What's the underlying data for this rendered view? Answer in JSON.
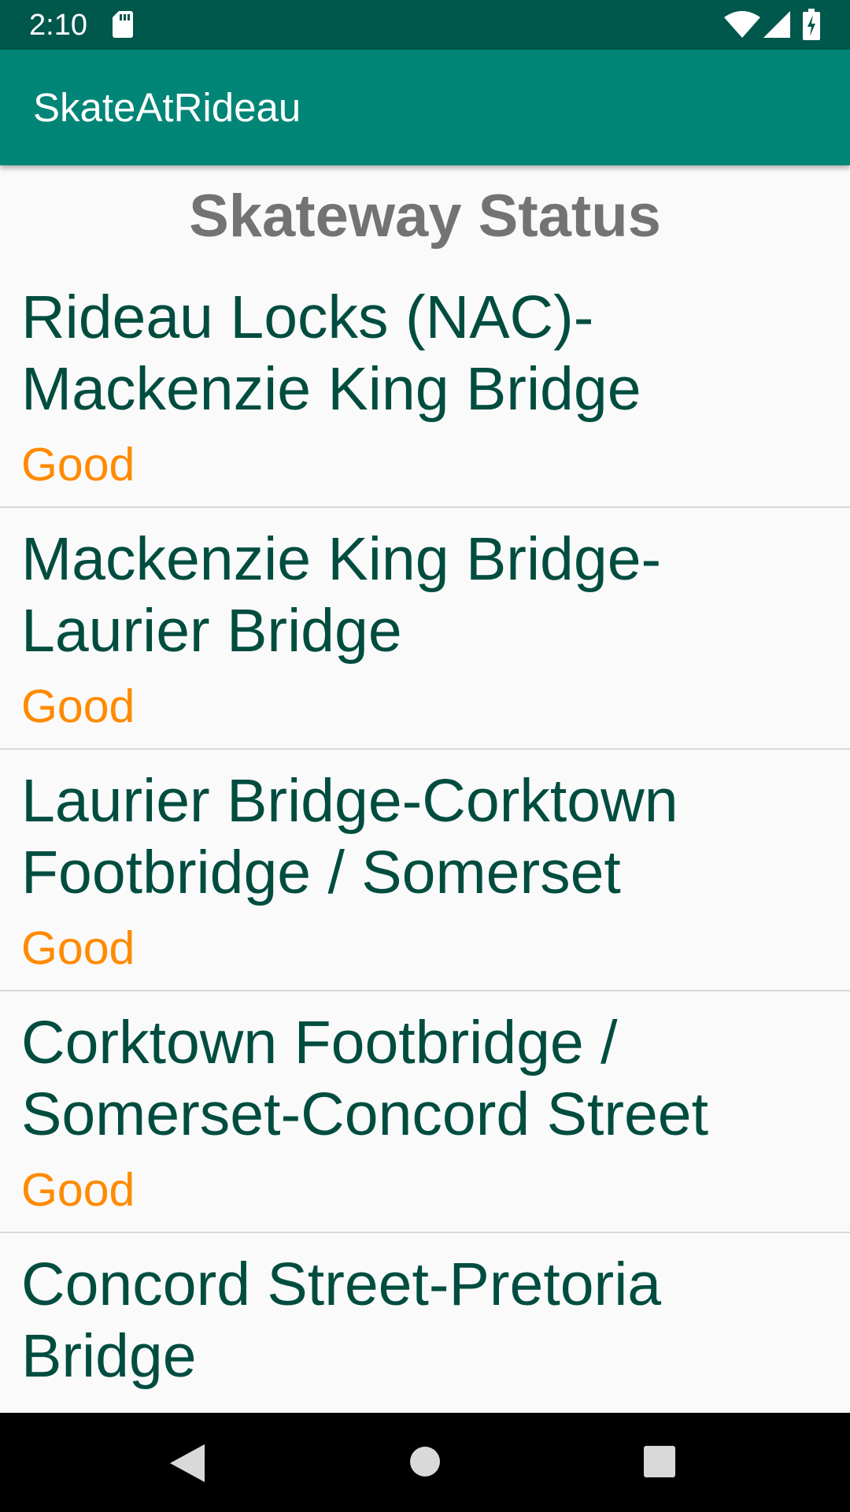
{
  "status_bar": {
    "time": "2:10",
    "icons": [
      "sd-card-icon",
      "wifi-icon",
      "cell-signal-icon",
      "battery-charging-icon"
    ]
  },
  "app_bar": {
    "title": "SkateAtRideau"
  },
  "main": {
    "heading": "Skateway Status",
    "segments": [
      {
        "name": "Rideau Locks (NAC)-Mackenzie King Bridge",
        "status": "Good"
      },
      {
        "name": "Mackenzie King Bridge-Laurier Bridge",
        "status": "Good"
      },
      {
        "name": "Laurier Bridge-Corktown Footbridge / Somerset",
        "status": "Good"
      },
      {
        "name": "Corktown Footbridge / Somerset-Concord Street",
        "status": "Good"
      },
      {
        "name": "Concord Street-Pretoria Bridge",
        "status": ""
      }
    ]
  },
  "nav_bar": {
    "icons": [
      "back-icon",
      "home-icon",
      "recents-icon"
    ]
  },
  "colors": {
    "status_bar": "#00574b",
    "app_bar": "#008577",
    "segment_name": "#004d40",
    "status_good": "#ff8a00",
    "heading": "#737373"
  }
}
